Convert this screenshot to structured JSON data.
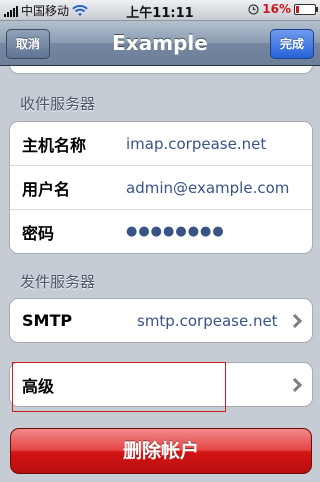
{
  "status_bar": {
    "carrier": "中国移动",
    "time": "上午11:11",
    "battery_percent": "16%",
    "battery_level": 0.16,
    "colors": {
      "battery": "#d0171f"
    }
  },
  "nav": {
    "cancel_label": "取消",
    "title": "Example",
    "done_label": "完成"
  },
  "incoming": {
    "header": "收件服务器",
    "rows": [
      {
        "label": "主机名称",
        "value": "imap.corpease.net"
      },
      {
        "label": "用户名",
        "value": "admin@example.com"
      },
      {
        "label": "密码",
        "value": "●●●●●●●●"
      }
    ]
  },
  "outgoing": {
    "header": "发件服务器",
    "smtp_label": "SMTP",
    "smtp_value": "smtp.corpease.net"
  },
  "advanced": {
    "label": "高级"
  },
  "delete_account": {
    "label": "删除帐户"
  },
  "icons": [
    "wifi-icon",
    "alarm-icon",
    "battery-icon",
    "chevron-right-icon"
  ]
}
